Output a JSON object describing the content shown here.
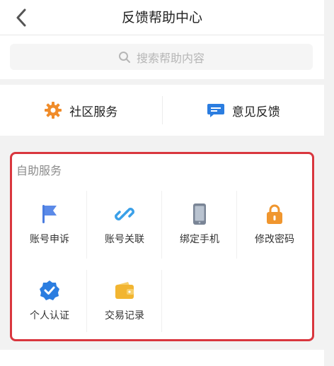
{
  "header": {
    "title": "反馈帮助中心"
  },
  "search": {
    "placeholder": "搜索帮助内容"
  },
  "quick_actions": [
    {
      "label": "社区服务",
      "icon": "gear-icon",
      "color": "#f08c2a"
    },
    {
      "label": "意见反馈",
      "icon": "chat-bubble-icon",
      "color": "#2b7de0"
    }
  ],
  "self_service": {
    "title": "自助服务",
    "items": [
      {
        "label": "账号申诉",
        "icon": "flag-icon",
        "color": "#4a7ce0"
      },
      {
        "label": "账号关联",
        "icon": "link-icon",
        "color": "#3aa0e8"
      },
      {
        "label": "绑定手机",
        "icon": "phone-icon",
        "color": "#7a8596"
      },
      {
        "label": "修改密码",
        "icon": "lock-icon",
        "color": "#f0962e"
      },
      {
        "label": "个人认证",
        "icon": "verified-badge-icon",
        "color": "#2b7de0"
      },
      {
        "label": "交易记录",
        "icon": "wallet-icon",
        "color": "#f2b531"
      }
    ]
  },
  "colors": {
    "highlight_border": "#d9363e",
    "background": "#f2f2f2"
  }
}
